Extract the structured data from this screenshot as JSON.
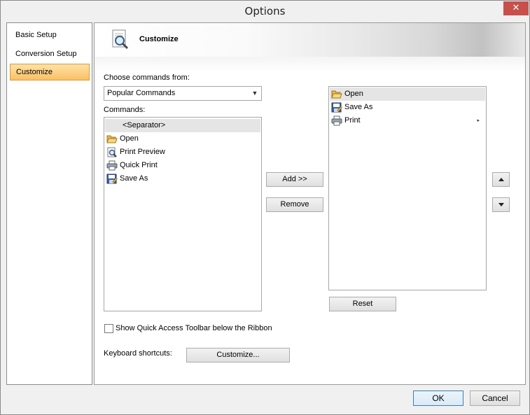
{
  "window": {
    "title": "Options",
    "close_label": "✕"
  },
  "sidebar": {
    "items": [
      {
        "label": "Basic Setup",
        "selected": false
      },
      {
        "label": "Conversion Setup",
        "selected": false
      },
      {
        "label": "Customize",
        "selected": true
      }
    ]
  },
  "header": {
    "title": "Customize",
    "icon": "magnifier-document-icon"
  },
  "commands_from": {
    "label": "Choose commands from:",
    "selected": "Popular Commands"
  },
  "commands": {
    "label": "Commands:",
    "items": [
      {
        "label": "<Separator>",
        "icon": "none",
        "selected": true
      },
      {
        "label": "Open",
        "icon": "folder-open-icon"
      },
      {
        "label": "Print Preview",
        "icon": "print-preview-icon"
      },
      {
        "label": "Quick Print",
        "icon": "printer-icon"
      },
      {
        "label": "Save As",
        "icon": "save-as-icon"
      }
    ]
  },
  "actions": {
    "add": "Add >>",
    "remove": "Remove",
    "reset": "Reset"
  },
  "toolbar_items": [
    {
      "label": "Open",
      "icon": "folder-open-icon",
      "selected": true
    },
    {
      "label": "Save As",
      "icon": "save-as-icon"
    },
    {
      "label": "Print",
      "icon": "printer-icon",
      "submenu_indicator": "▸"
    }
  ],
  "options": {
    "show_qat_below_label": "Show Quick Access Toolbar below the Ribbon",
    "show_qat_below_checked": false
  },
  "keyboard": {
    "label": "Keyboard shortcuts:",
    "button": "Customize..."
  },
  "footer": {
    "ok": "OK",
    "cancel": "Cancel"
  },
  "colors": {
    "selected_nav": "#f9c067",
    "list_selection": "#e5e5e5",
    "close_button": "#c7504b"
  }
}
